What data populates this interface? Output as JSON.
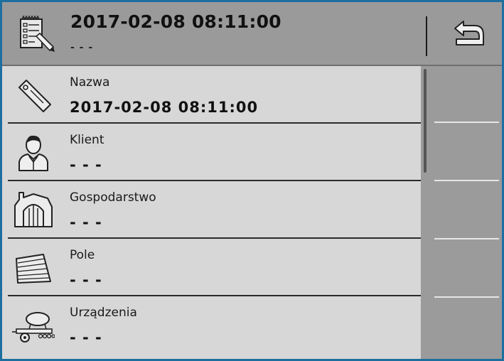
{
  "header": {
    "title": "2017-02-08 08:11:00",
    "subtitle": "- - -",
    "icon": "task-list-icon",
    "back_icon": "back-arrow-icon"
  },
  "fields": [
    {
      "icon": "tag-icon",
      "label": "Nazwa",
      "value": "2017-02-08 08:11:00"
    },
    {
      "icon": "customer-icon",
      "label": "Klient",
      "value": "- - -"
    },
    {
      "icon": "farm-icon",
      "label": "Gospodarstwo",
      "value": "- - -"
    },
    {
      "icon": "field-icon",
      "label": "Pole",
      "value": "- - -"
    },
    {
      "icon": "machine-icon",
      "label": "Urządzenia",
      "value": "- - -"
    }
  ],
  "colors": {
    "frame_border": "#1e6fa0",
    "header_bg": "#9a9a9a",
    "list_bg": "#d7d7d7",
    "softkey_bg": "#9b9b9b"
  }
}
